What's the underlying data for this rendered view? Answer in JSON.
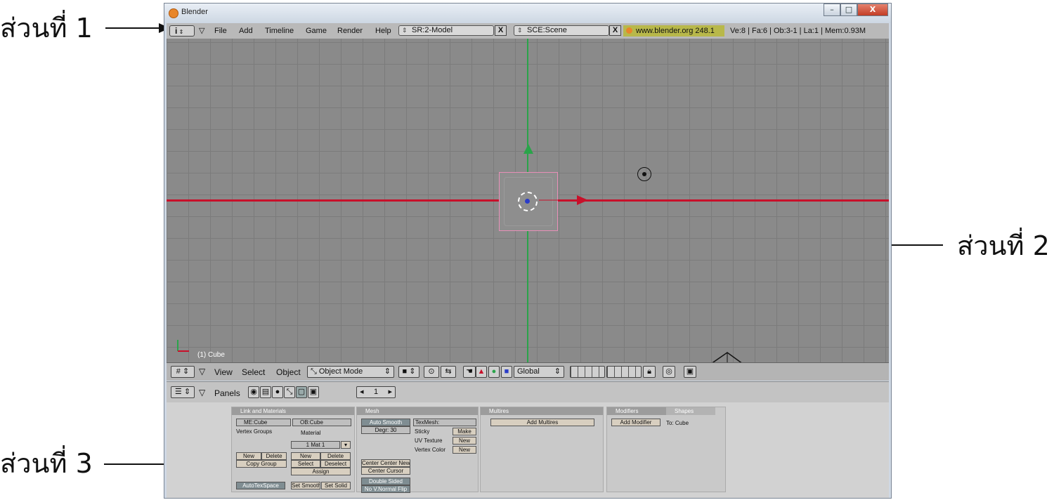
{
  "callouts": {
    "part1": "ส่วนที่ 1",
    "part2": "ส่วนที่ 2",
    "part3": "ส่วนที่ 3"
  },
  "window": {
    "title": "Blender",
    "minimize": "–",
    "maximize": "□",
    "close": "X"
  },
  "top_header": {
    "info_glyph": "i",
    "menus": [
      "File",
      "Add",
      "Timeline",
      "Game",
      "Render",
      "Help"
    ],
    "screen_field": "SR:2-Model",
    "scene_field": "SCE:Scene",
    "close_x": "X",
    "url": "www.blender.org 248.1",
    "stats": "Ve:8 | Fa:6 | Ob:3-1 | La:1 | Mem:0.93M"
  },
  "viewport": {
    "object_label": "(1) Cube",
    "axis_x_color": "#c8102a",
    "axis_y_color": "#2aa44a",
    "selection_color": "#e88fb8"
  },
  "header_3d": {
    "menus": [
      "View",
      "Select",
      "Object"
    ],
    "mode": "Object Mode",
    "orientation": "Global"
  },
  "buttons_header": {
    "label": "Panels",
    "frame": "1"
  },
  "panels": {
    "link_materials": {
      "title": "Link and Materials",
      "me_field": "ME:Cube",
      "ob_field": "OB:Cube",
      "vertex_groups": "Vertex Groups",
      "material": "Material",
      "mat_count": "1 Mat 1",
      "new": "New",
      "delete": "Delete",
      "copy_group": "Copy Group",
      "select": "Select",
      "deselect": "Deselect",
      "assign": "Assign",
      "auto_tex": "AutoTexSpace",
      "set_smooth": "Set Smooth",
      "set_solid": "Set Solid"
    },
    "mesh": {
      "title": "Mesh",
      "auto_smooth": "Auto Smooth",
      "degr": "Degr: 30",
      "tex_mesh": "TexMesh:",
      "sticky": "Sticky",
      "uv_texture": "UV Texture",
      "vertex_color": "Vertex Color",
      "make": "Make",
      "new": "New",
      "center": "Center  Center New",
      "center_cursor": "Center Cursor",
      "double_sided": "Double Sided",
      "no_vnormal": "No V.Normal Flip"
    },
    "multires": {
      "title": "Multires",
      "add": "Add Multires"
    },
    "modifiers": {
      "title": "Modifiers",
      "tab_shapes": "Shapes",
      "add": "Add Modifier",
      "to": "To: Cube"
    }
  }
}
